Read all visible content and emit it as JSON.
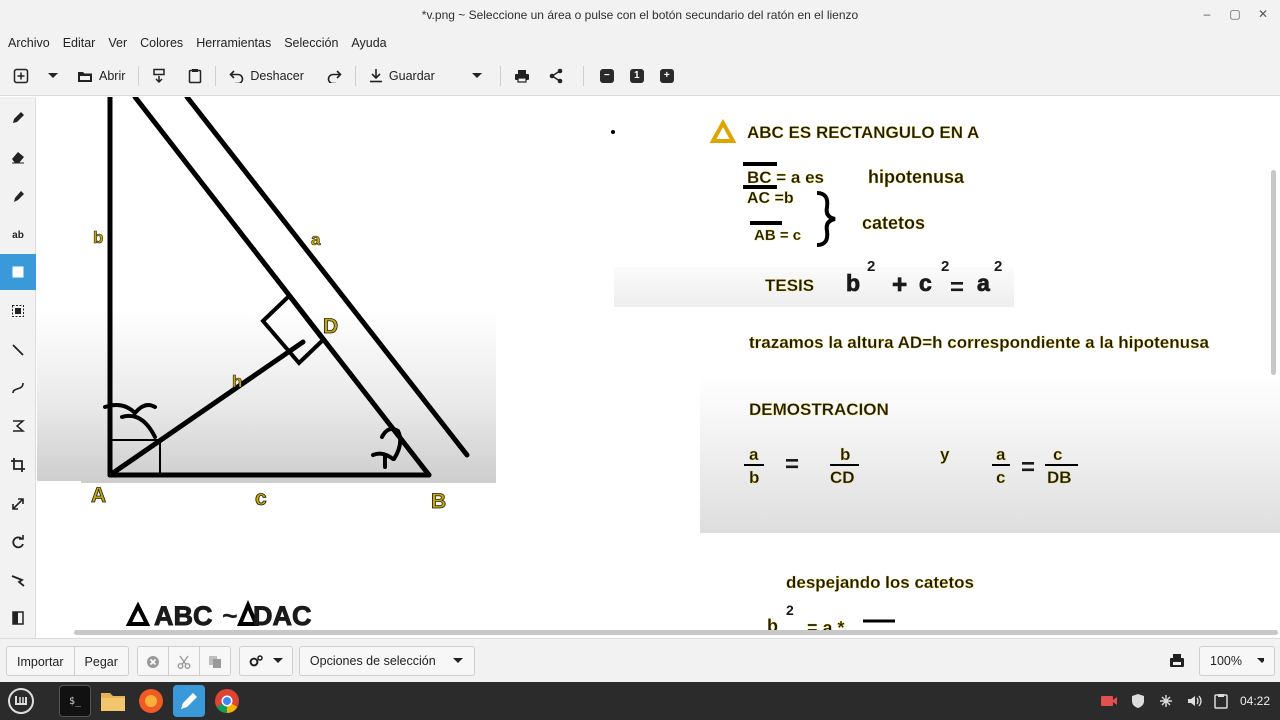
{
  "window": {
    "title": "*v.png ~ Seleccione un área o pulse con el botón secundario del ratón en el lienzo",
    "controls": [
      "–",
      "▢",
      "✕"
    ]
  },
  "menu": [
    "Archivo",
    "Editar",
    "Ver",
    "Colores",
    "Herramientas",
    "Selección",
    "Ayuda"
  ],
  "toolbar": {
    "open_label": "Abrir",
    "undo_label": "Deshacer",
    "save_label": "Guardar",
    "zoom_one_label": "1"
  },
  "bottom": {
    "import_label": "Importar",
    "paste_label": "Pegar",
    "selection_options_label": "Opciones de selección",
    "zoom_value": "100%"
  },
  "taskbar": {
    "clock": "04:22"
  },
  "canvas_text": {
    "label_b_side": "b",
    "label_a_side": "a",
    "label_D": "D",
    "label_h": "h",
    "label_A": "A",
    "label_c": "c",
    "label_B": "B",
    "similar_left": "ABC",
    "similar_tilde": "~",
    "similar_right": "DAC",
    "heading": "ABC  ES RECTANGULO EN    A",
    "bc_line": "BC = a es",
    "hipotenusa": "hipotenusa",
    "ac_line": "AC  =b",
    "ab_line": "AB = c",
    "catetos": "catetos",
    "tesis": "TESIS",
    "f_b": "b",
    "f_plus": "+",
    "f_c": "c",
    "f_eq": "=",
    "f_a": "a",
    "f_exp": "2",
    "altura": "trazamos la altura AD=h correspondiente a la hipotenusa",
    "demostracion": "DEMOSTRACION",
    "fr1_num": "a",
    "fr1_den": "b",
    "fr2_num": "b",
    "fr2_den": "CD",
    "fr_y": "y",
    "fr3_num": "a",
    "fr3_den": "c",
    "fr4_num": "c",
    "fr4_den": "DB",
    "despejando": "despejando los catetos",
    "partial_b": "b",
    "partial_rest": "= a *"
  }
}
